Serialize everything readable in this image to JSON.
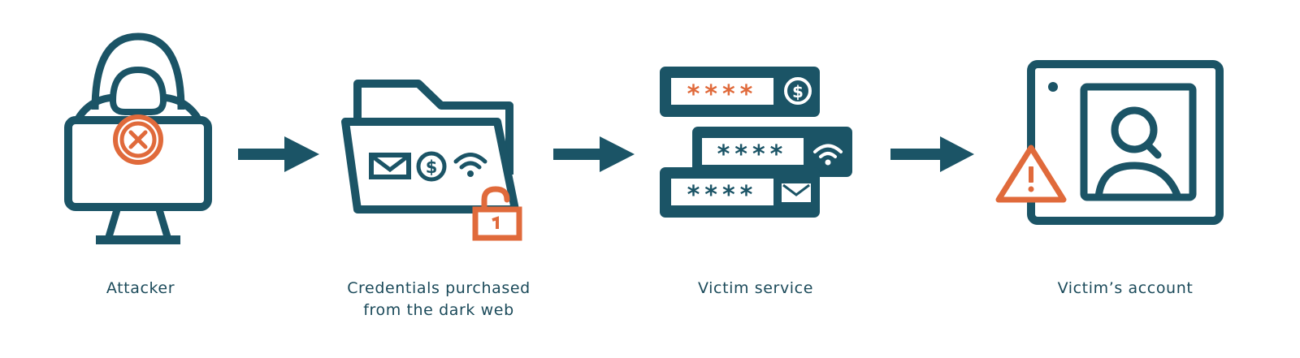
{
  "colors": {
    "primary": "#1b5466",
    "accent": "#e06a3b",
    "background": "#ffffff"
  },
  "steps": [
    {
      "label": "Attacker",
      "icon": "hacker-computer-icon"
    },
    {
      "label": "Credentials purchased\nfrom the dark web",
      "icon": "leaked-credentials-folder-icon"
    },
    {
      "label": "Victim service",
      "icon": "credential-server-stack-icon"
    },
    {
      "label": "Victim’s account",
      "icon": "compromised-account-icon"
    }
  ],
  "connectors": [
    "arrow-right-icon",
    "arrow-right-icon",
    "arrow-right-icon"
  ]
}
